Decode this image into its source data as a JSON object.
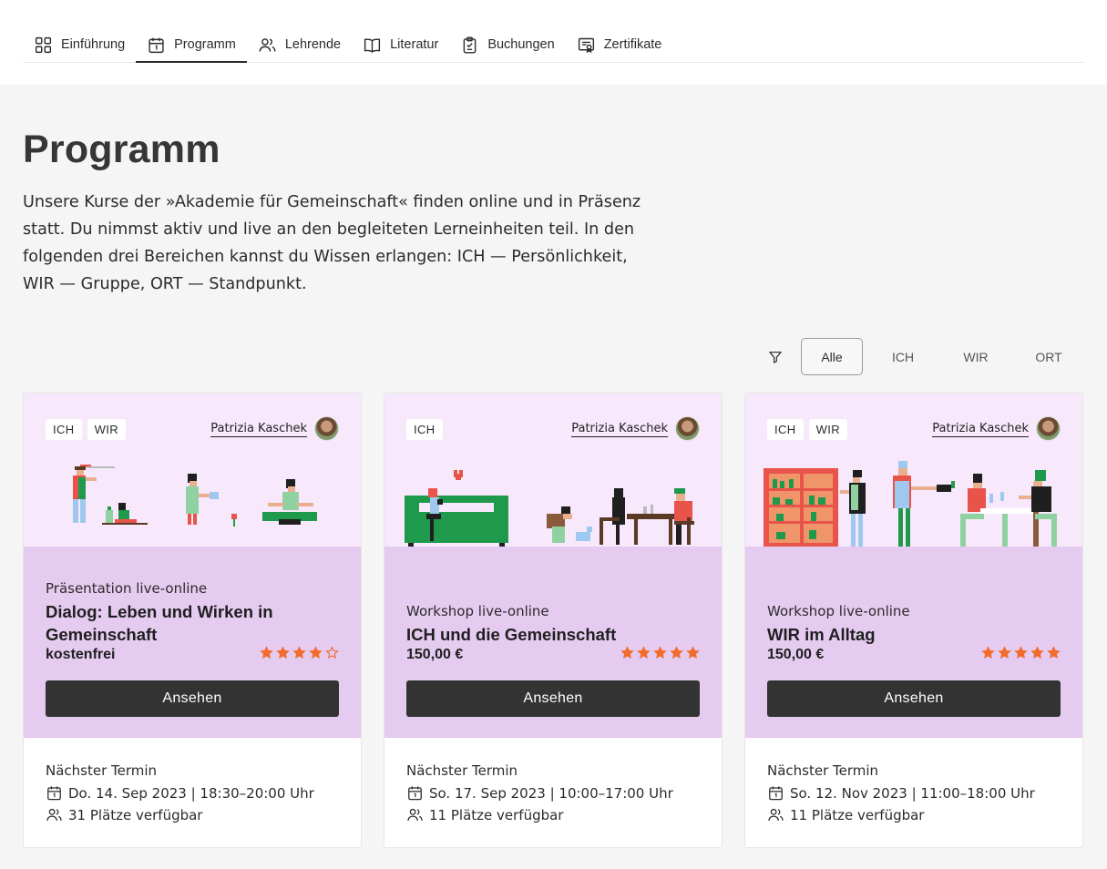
{
  "nav": {
    "tabs": [
      {
        "label": "Einführung",
        "icon": "grid-icon"
      },
      {
        "label": "Programm",
        "icon": "calendar-icon",
        "active": true
      },
      {
        "label": "Lehrende",
        "icon": "people-icon"
      },
      {
        "label": "Literatur",
        "icon": "book-icon"
      },
      {
        "label": "Buchungen",
        "icon": "clipboard-icon"
      },
      {
        "label": "Zertifikate",
        "icon": "certificate-icon"
      }
    ]
  },
  "page": {
    "title": "Programm",
    "intro": "Unsere Kurse der »Akademie für Gemeinschaft« finden online und in Präsenz statt. Du nimmst aktiv und live an den begleiteten Lerneinheiten teil. In den folgenden drei Bereichen kannst du Wissen erlangen: ICH — Persönlichkeit, WIR — Gruppe, ORT — Standpunkt."
  },
  "filter": {
    "icon": "filter-icon",
    "options": [
      "Alle",
      "ICH",
      "WIR",
      "ORT"
    ],
    "selected": "Alle"
  },
  "colors": {
    "hero_bg": "#f8e8fb",
    "body_bg": "#e5cbf0",
    "button_bg": "#333333",
    "star": "#f26b2d"
  },
  "cards": [
    {
      "tags": [
        "ICH",
        "WIR"
      ],
      "teacher": "Patrizia Kaschek",
      "kind": "Präsentation live-online",
      "title": "Dialog: Leben und Wirken in Gemeinschaft",
      "price": "kostenfrei",
      "rating": 4,
      "button": "Ansehen",
      "next_label": "Nächster Termin",
      "date": "Do. 14. Sep 2023 | 18:30–20:00 Uhr",
      "places": "31 Plätze verfügbar"
    },
    {
      "tags": [
        "ICH"
      ],
      "teacher": "Patrizia Kaschek",
      "kind": "Workshop live-online",
      "title": "ICH und die Gemeinschaft",
      "price": "150,00 €",
      "rating": 5,
      "button": "Ansehen",
      "next_label": "Nächster Termin",
      "date": "So. 17. Sep 2023 | 10:00–17:00 Uhr",
      "places": "11 Plätze verfügbar"
    },
    {
      "tags": [
        "ICH",
        "WIR"
      ],
      "teacher": "Patrizia Kaschek",
      "kind": "Workshop live-online",
      "title": "WIR im Alltag",
      "price": "150,00 €",
      "rating": 5,
      "button": "Ansehen",
      "next_label": "Nächster Termin",
      "date": "So. 12. Nov 2023 | 11:00–18:00 Uhr",
      "places": "11 Plätze verfügbar"
    }
  ]
}
